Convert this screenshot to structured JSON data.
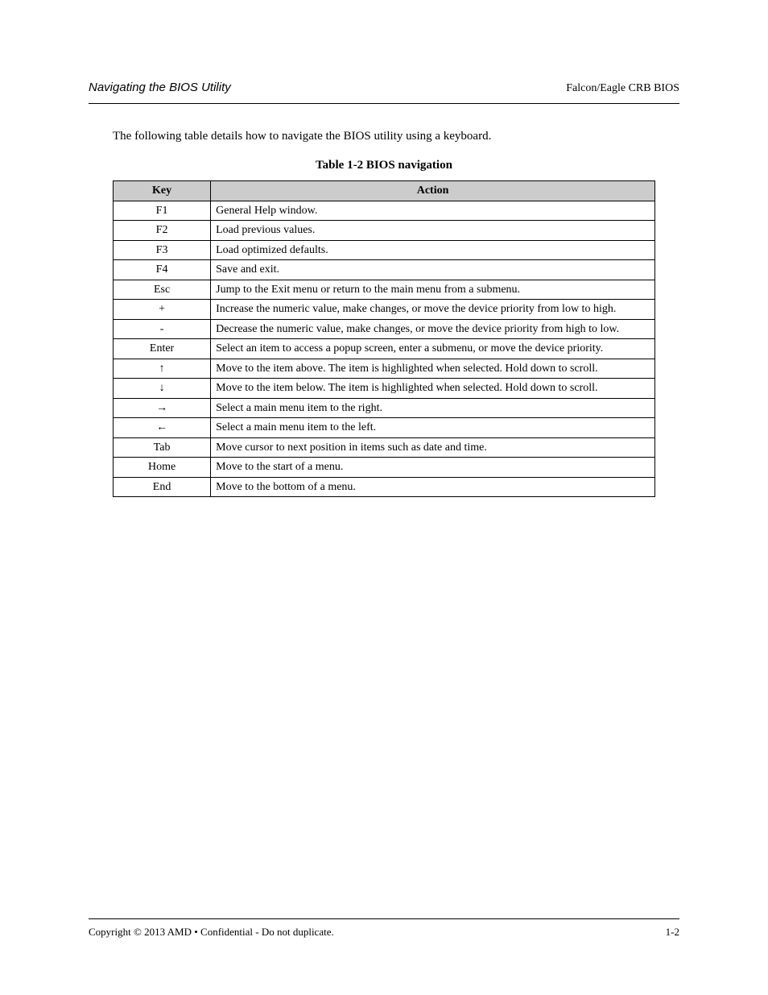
{
  "header": {
    "left": "Navigating the BIOS Utility",
    "right": "Falcon/Eagle CRB BIOS"
  },
  "intro": "The following table details how to navigate the BIOS utility using a keyboard.",
  "table": {
    "title": "Table 1-2   BIOS navigation",
    "headers": [
      "Key",
      "Action"
    ],
    "rows": [
      {
        "key": "F1",
        "action": "General Help window."
      },
      {
        "key": "F2",
        "action": "Load previous values."
      },
      {
        "key": "F3",
        "action": "Load optimized defaults."
      },
      {
        "key": "F4",
        "action": "Save and exit."
      },
      {
        "key": "Esc",
        "action": "Jump to the Exit menu or return to the main menu from a submenu."
      },
      {
        "key": "+",
        "action": "Increase the numeric value, make changes, or move the device priority from low to high."
      },
      {
        "key": "-",
        "action": "Decrease the numeric value, make changes, or move the device priority from high to low."
      },
      {
        "key": "Enter",
        "action": "Select an item to access a popup screen, enter a submenu, or move the device priority."
      },
      {
        "key": "↑",
        "action": "Move to the item above. The item is highlighted when selected. Hold down to scroll."
      },
      {
        "key": "↓",
        "action": "Move to the item below. The item is highlighted when selected. Hold down to scroll."
      },
      {
        "key": "→",
        "action": "Select a main menu item to the right."
      },
      {
        "key": "←",
        "action": "Select a main menu item to the left."
      },
      {
        "key": "Tab",
        "action": "Move cursor to next position in items such as date and time."
      },
      {
        "key": "Home",
        "action": "Move to the start of a menu."
      },
      {
        "key": "End",
        "action": "Move to the bottom of a menu."
      }
    ]
  },
  "footer": {
    "left": "Copyright © 2013 AMD • Confidential - Do not duplicate.",
    "right": "1-2"
  }
}
